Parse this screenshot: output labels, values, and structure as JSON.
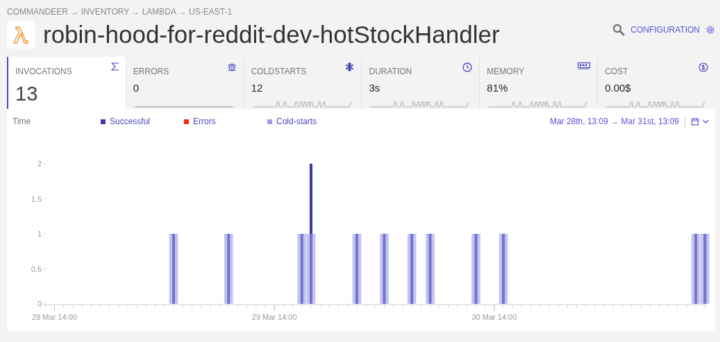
{
  "breadcrumb": "COMMANDEER → INVENTORY → LAMBDA → US-EAST-1",
  "title": "robin-hood-for-reddit-dev-hotStockHandler",
  "configuration_link": "CONFIGURATION",
  "metrics": [
    {
      "label": "INVOCATIONS",
      "value": "13",
      "selected": true
    },
    {
      "label": "ERRORS",
      "value": "0",
      "selected": false
    },
    {
      "label": "COLDSTARTS",
      "value": "12",
      "selected": false
    },
    {
      "label": "DURATION",
      "value": "3s",
      "selected": false
    },
    {
      "label": "MEMORY",
      "value": "81%",
      "selected": false
    },
    {
      "label": "COST",
      "value": "0.00$",
      "selected": false
    }
  ],
  "chart_panel": {
    "time_label": "Time",
    "date_range": "Mar 28th, 13:09 → Mar 31st, 13:09",
    "chart_data": {
      "type": "bar",
      "stacked": false,
      "categories": [
        null,
        "28 Mar 14:00",
        null,
        null,
        null,
        null,
        null,
        null,
        null,
        null,
        null,
        null,
        null,
        null,
        null,
        null,
        null,
        null,
        null,
        null,
        null,
        null,
        null,
        null,
        null,
        "29 Mar 14:00",
        null,
        null,
        null,
        null,
        null,
        null,
        null,
        null,
        null,
        null,
        null,
        null,
        null,
        null,
        null,
        null,
        null,
        null,
        null,
        null,
        null,
        null,
        null,
        "30 Mar 14:00",
        null,
        null,
        null,
        null,
        null,
        null,
        null,
        null,
        null,
        null,
        null,
        null,
        null,
        null,
        null,
        null,
        null,
        null,
        null,
        null,
        null,
        null,
        null
      ],
      "ylim": [
        0,
        2
      ],
      "yticks": [
        0,
        0.5,
        1,
        1.5,
        2
      ],
      "series": [
        {
          "name": "Successful",
          "color": "#3b37a8",
          "values": [
            0,
            0,
            0,
            0,
            0,
            0,
            0,
            0,
            0,
            0,
            0,
            0,
            0,
            0,
            1,
            0,
            0,
            0,
            0,
            0,
            1,
            0,
            0,
            0,
            0,
            0,
            0,
            0,
            1,
            2,
            0,
            0,
            0,
            0,
            1,
            0,
            0,
            1,
            0,
            0,
            1,
            0,
            1,
            0,
            0,
            0,
            0,
            1,
            0,
            0,
            1,
            0,
            0,
            0,
            0,
            0,
            0,
            0,
            0,
            0,
            0,
            0,
            0,
            0,
            0,
            0,
            0,
            0,
            0,
            0,
            0,
            1,
            1
          ]
        },
        {
          "name": "Errors",
          "color": "#f0300a",
          "values": [
            0,
            0,
            0,
            0,
            0,
            0,
            0,
            0,
            0,
            0,
            0,
            0,
            0,
            0,
            0,
            0,
            0,
            0,
            0,
            0,
            0,
            0,
            0,
            0,
            0,
            0,
            0,
            0,
            0,
            0,
            0,
            0,
            0,
            0,
            0,
            0,
            0,
            0,
            0,
            0,
            0,
            0,
            0,
            0,
            0,
            0,
            0,
            0,
            0,
            0,
            0,
            0,
            0,
            0,
            0,
            0,
            0,
            0,
            0,
            0,
            0,
            0,
            0,
            0,
            0,
            0,
            0,
            0,
            0,
            0,
            0,
            0,
            0
          ]
        },
        {
          "name": "Cold-starts",
          "color": "#9b9be6",
          "values": [
            0,
            0,
            0,
            0,
            0,
            0,
            0,
            0,
            0,
            0,
            0,
            0,
            0,
            0,
            1,
            0,
            0,
            0,
            0,
            0,
            1,
            0,
            0,
            0,
            0,
            0,
            0,
            0,
            1,
            1,
            0,
            0,
            0,
            0,
            1,
            0,
            0,
            1,
            0,
            0,
            1,
            0,
            1,
            0,
            0,
            0,
            0,
            1,
            0,
            0,
            1,
            0,
            0,
            0,
            0,
            0,
            0,
            0,
            0,
            0,
            0,
            0,
            0,
            0,
            0,
            0,
            0,
            0,
            0,
            0,
            0,
            1,
            1
          ]
        }
      ]
    }
  }
}
